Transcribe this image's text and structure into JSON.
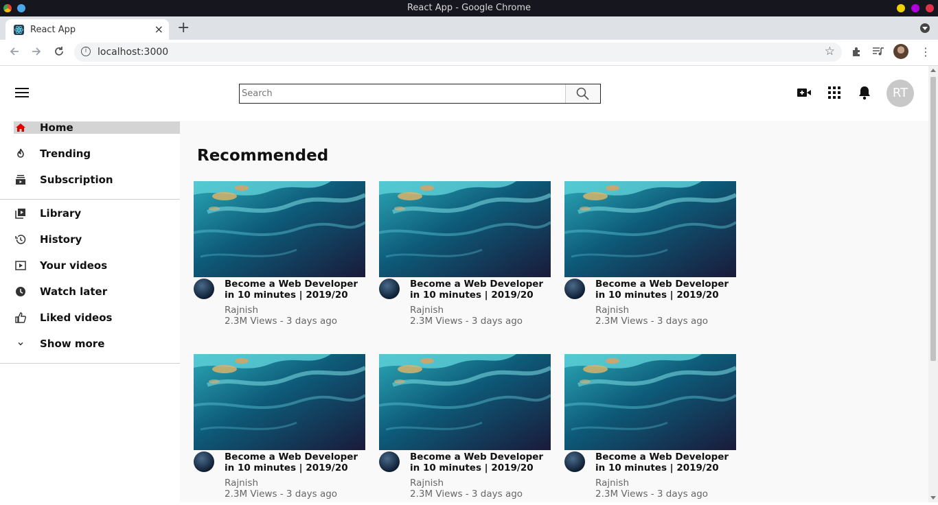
{
  "window": {
    "title": "React App - Google Chrome"
  },
  "tab": {
    "title": "React App",
    "close": "×"
  },
  "new_tab": "+",
  "address": {
    "url": "localhost:3000",
    "info": "i"
  },
  "header": {
    "search_placeholder": "Search",
    "avatar_initials": "RT"
  },
  "sidebar": {
    "items": [
      {
        "label": "Home",
        "icon": "home-icon",
        "active": true
      },
      {
        "label": "Trending",
        "icon": "fire-icon"
      },
      {
        "label": "Subscription",
        "icon": "subscriptions-icon"
      },
      {
        "label": "Library",
        "icon": "library-icon"
      },
      {
        "label": "History",
        "icon": "history-icon"
      },
      {
        "label": "Your videos",
        "icon": "your-videos-icon"
      },
      {
        "label": "Watch later",
        "icon": "clock-icon"
      },
      {
        "label": "Liked videos",
        "icon": "thumbs-up-icon"
      },
      {
        "label": "Show more",
        "icon": "chevron-down-icon"
      }
    ]
  },
  "main": {
    "heading": "Recommended",
    "videos": [
      {
        "title": "Become a Web Developer in 10 minutes | 2019/20",
        "channel": "Rajnish",
        "meta": "2.3M Views - 3 days ago"
      },
      {
        "title": "Become a Web Developer in 10 minutes | 2019/20",
        "channel": "Rajnish",
        "meta": "2.3M Views - 3 days ago"
      },
      {
        "title": "Become a Web Developer in 10 minutes | 2019/20",
        "channel": "Rajnish",
        "meta": "2.3M Views - 3 days ago"
      },
      {
        "title": "Become a Web Developer in 10 minutes | 2019/20",
        "channel": "Rajnish",
        "meta": "2.3M Views - 3 days ago"
      },
      {
        "title": "Become a Web Developer in 10 minutes | 2019/20",
        "channel": "Rajnish",
        "meta": "2.3M Views - 3 days ago"
      },
      {
        "title": "Become a Web Developer in 10 minutes | 2019/20",
        "channel": "Rajnish",
        "meta": "2.3M Views - 3 days ago"
      }
    ]
  },
  "colors": {
    "home_icon": "#e00000",
    "active_bg": "#d4d4d4",
    "content_bg": "#f9f9f9"
  }
}
